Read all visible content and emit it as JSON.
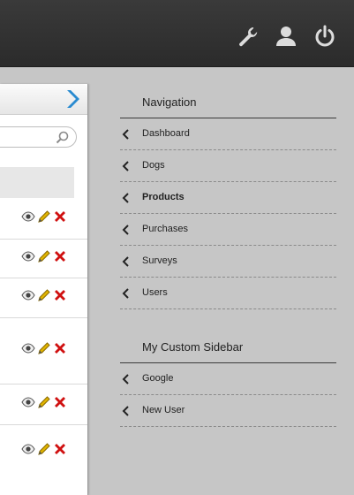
{
  "topbar": {
    "icons": [
      "wrench-icon",
      "user-icon",
      "power-icon"
    ]
  },
  "panel": {
    "rows": [
      {
        "actions": [
          "eye-icon",
          "pencil-icon",
          "delete-icon"
        ]
      },
      {
        "actions": [
          "eye-icon",
          "pencil-icon",
          "delete-icon"
        ]
      },
      {
        "actions": [
          "eye-icon",
          "pencil-icon",
          "delete-icon"
        ]
      },
      {
        "actions": [
          "eye-icon",
          "pencil-icon",
          "delete-icon"
        ]
      },
      {
        "actions": [
          "eye-icon",
          "pencil-icon",
          "delete-icon"
        ]
      },
      {
        "actions": [
          "eye-icon",
          "pencil-icon",
          "delete-icon"
        ]
      }
    ]
  },
  "sidebar": {
    "navigation_title": "Navigation",
    "navigation_items": [
      {
        "label": "Dashboard",
        "active": false
      },
      {
        "label": "Dogs",
        "active": false
      },
      {
        "label": "Products",
        "active": true
      },
      {
        "label": "Purchases",
        "active": false
      },
      {
        "label": "Surveys",
        "active": false
      },
      {
        "label": "Users",
        "active": false
      }
    ],
    "custom_title": "My Custom Sidebar",
    "custom_items": [
      {
        "label": "Google"
      },
      {
        "label": "New User"
      }
    ]
  },
  "colors": {
    "accent_blue": "#2a8bd0",
    "delete_red": "#d01010",
    "pencil_yellow": "#e0b400"
  }
}
